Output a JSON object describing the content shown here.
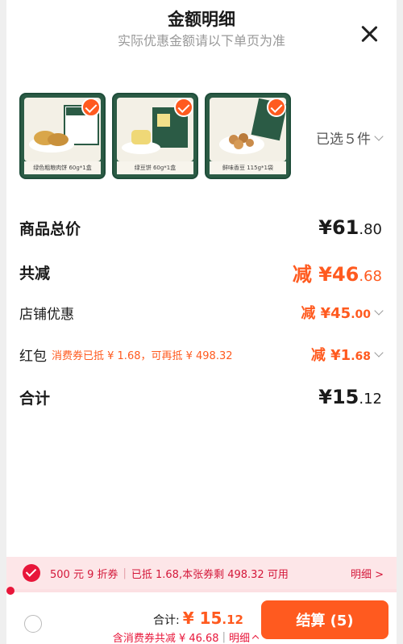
{
  "header": {
    "title": "金额明细",
    "subtitle": "实际优惠金额请以下单页为准"
  },
  "products": [
    {
      "caption": "绿色粗粮肉饼 60g*1盒"
    },
    {
      "caption": "绿豆饼 60g*1盒"
    },
    {
      "caption": "鲜味香豆 115g*1袋"
    }
  ],
  "selection": {
    "label": "已选５件"
  },
  "summary": {
    "total_label": "商品总价",
    "total_main": "¥61",
    "total_dec": ".80",
    "reduce_label": "共减",
    "reduce_main": "减 ¥46",
    "reduce_dec": ".68",
    "shop_label": "店铺优惠",
    "shop_main": "减 ¥45",
    "shop_dec": ".00",
    "hongbao_label": "红包",
    "hongbao_note": "消费券已抵 ¥ 1.68，可再抵 ¥ 498.32",
    "hongbao_main": "减 ¥1",
    "hongbao_dec": ".68",
    "sum_label": "合计",
    "sum_main": "¥15",
    "sum_dec": ".12"
  },
  "coupon": {
    "name": "500 元 9 折券",
    "info": "已抵 1.68,本张券剩 498.32 可用",
    "detail": "明细 >"
  },
  "footer": {
    "total_label": "合计:",
    "total_main": "¥ 15",
    "total_dec": ".12",
    "sub": "含消费券共减 ¥ 46.68",
    "sub_detail": "明细",
    "checkout": "结算 (5)"
  },
  "colors": {
    "accent": "#ff5a1f",
    "coupon": "#e8163a",
    "brand_green": "#1f4d3a"
  }
}
